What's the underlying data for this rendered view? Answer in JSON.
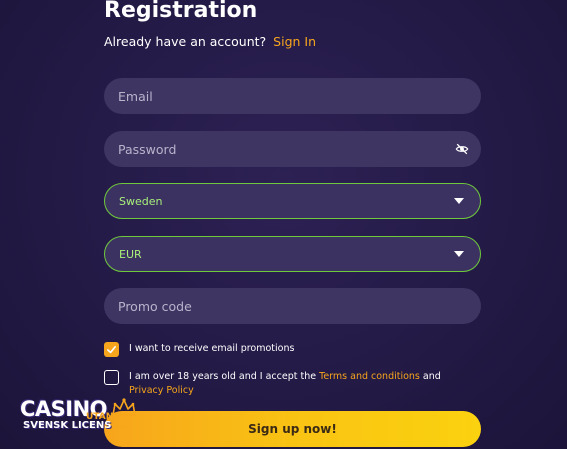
{
  "form": {
    "title": "Registration",
    "have_account": "Already have an account?",
    "sign_in": "Sign In",
    "email_placeholder": "Email",
    "password_placeholder": "Password",
    "country_value": "Sweden",
    "currency_value": "EUR",
    "promo_placeholder": "Promo code",
    "email_promotions_label": "I want to receive email promotions",
    "email_promotions_checked": true,
    "age_terms_label_prefix": "I am over 18 years old and I accept the",
    "terms_link": "Terms and conditions",
    "and_text": "and",
    "privacy_link": "Privacy Policy",
    "age_terms_checked": false,
    "submit_label": "Sign up now!"
  },
  "logo": {
    "casino": "CASINO",
    "utan": "UTAN",
    "svensk": "SVENSK LICENS",
    "com": ".com"
  },
  "colors": {
    "background": "#231a46",
    "field": "#3f3562",
    "accent_orange": "#f7a51c",
    "select_border": "#6fc93c",
    "select_text": "#a8f07a",
    "button_gradient_end": "#fbd20f"
  },
  "icons": {
    "password_toggle": "eye-off-icon",
    "select_caret": "caret-down-icon",
    "checkbox_check": "checkmark-icon"
  }
}
